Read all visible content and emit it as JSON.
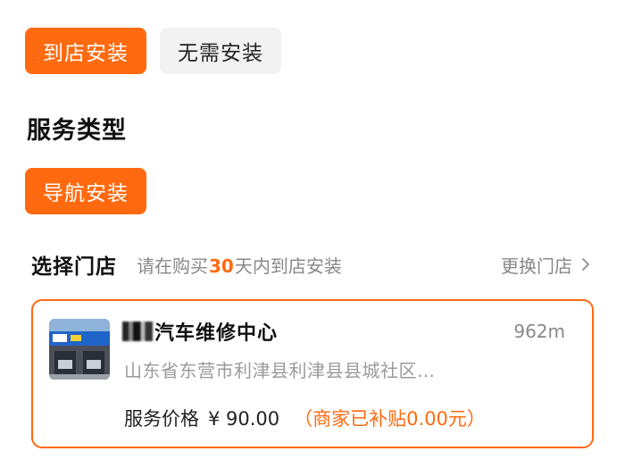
{
  "install_options": {
    "to_store": "到店安装",
    "no_install": "无需安装"
  },
  "service": {
    "section_title": "服务类型",
    "navigation_install": "导航安装"
  },
  "store_select": {
    "title": "选择门店",
    "hint_prefix": "请在购买",
    "hint_days": "30",
    "hint_suffix": "天内到店安装",
    "change_label": "更换门店",
    "chevron_icon": "chevron-right-icon"
  },
  "store": {
    "name": "汽车维修中心",
    "distance": "962m",
    "address": "山东省东营市利津县利津县县城社区…",
    "price_label": "服务价格",
    "price": "¥ 90.00",
    "subsidy": "（商家已补贴0.00元）",
    "thumb_icon": "store-photo"
  },
  "colors": {
    "accent": "#ff6a10",
    "muted": "#888888",
    "inactive_bg": "#f2f2f2"
  }
}
